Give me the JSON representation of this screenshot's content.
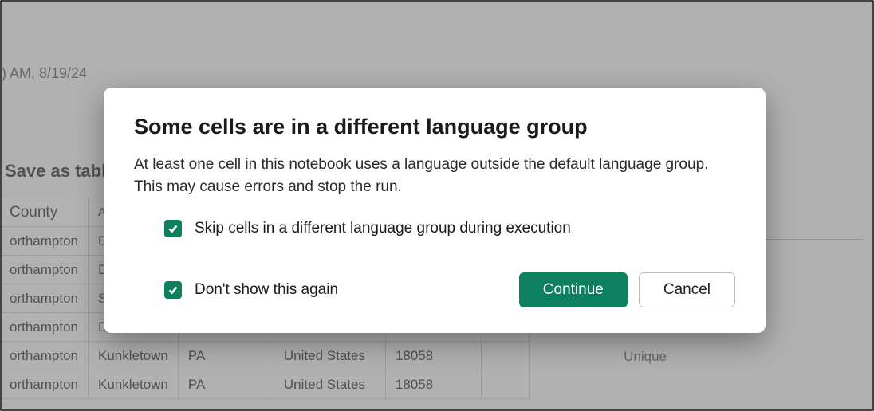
{
  "background": {
    "timestamp_partial": ") AM, 8/19/24",
    "toolbar": {
      "save_as_table": "Save as table"
    },
    "side_panel_label": "Unique",
    "table": {
      "headers": [
        "County",
        "A",
        "",
        "",
        "",
        ""
      ],
      "rows": [
        [
          "orthampton",
          "D",
          "",
          "",
          "",
          ""
        ],
        [
          "orthampton",
          "D",
          "",
          "",
          "",
          ""
        ],
        [
          "orthampton",
          "S",
          "",
          "",
          "",
          ""
        ],
        [
          "orthampton",
          "D",
          "",
          "",
          "",
          ""
        ],
        [
          "orthampton",
          "Kunkletown",
          "PA",
          "United States",
          "18058",
          ""
        ],
        [
          "orthampton",
          "Kunkletown",
          "PA",
          "United States",
          "18058",
          ""
        ]
      ]
    }
  },
  "modal": {
    "title": "Some cells are in a different language group",
    "body": "At least one cell in this notebook uses a language outside the default language group. This may cause errors and stop the run.",
    "checkbox_skip": {
      "checked": true,
      "label": "Skip cells in a different language group during execution"
    },
    "checkbox_dont_show": {
      "checked": true,
      "label": "Don't show this again"
    },
    "buttons": {
      "continue": "Continue",
      "cancel": "Cancel"
    }
  }
}
